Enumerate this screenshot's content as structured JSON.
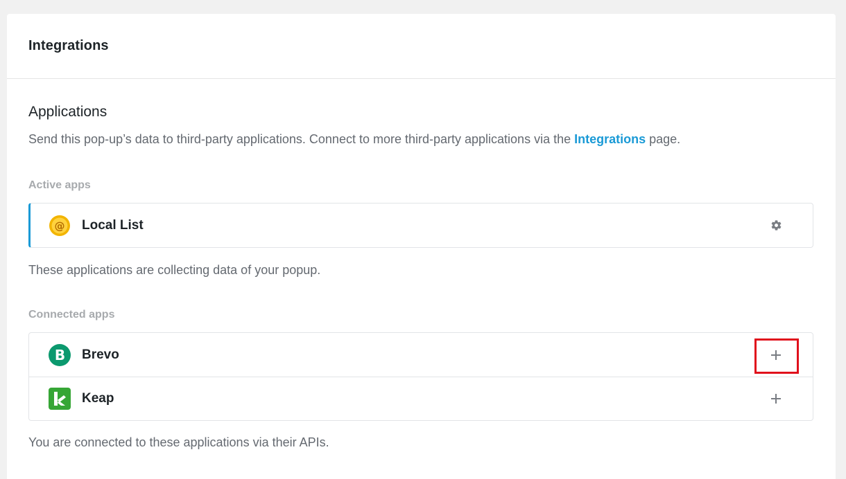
{
  "panel": {
    "title": "Integrations"
  },
  "applications": {
    "title": "Applications",
    "description_before": "Send this pop-up’s data to third-party applications. Connect to more third-party applications via the ",
    "description_link": "Integrations",
    "description_after": " page."
  },
  "active_apps": {
    "label": "Active apps",
    "items": [
      {
        "name": "Local List",
        "icon": "local-list-icon",
        "action_icon": "gear-icon"
      }
    ],
    "note": "These applications are collecting data of your popup."
  },
  "connected_apps": {
    "label": "Connected apps",
    "items": [
      {
        "name": "Brevo",
        "icon": "brevo-icon",
        "action_icon": "plus-icon"
      },
      {
        "name": "Keap",
        "icon": "keap-icon",
        "action_icon": "plus-icon"
      }
    ],
    "note": "You are connected to these applications via their APIs."
  },
  "colors": {
    "accent": "#1a9ad6",
    "brevo": "#0b996e",
    "keap": "#36a635",
    "local_list": "#f2b400",
    "highlight": "#e0101c"
  }
}
